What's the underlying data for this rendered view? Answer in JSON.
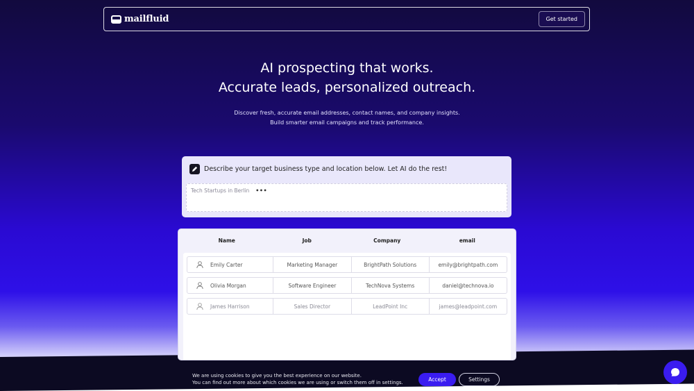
{
  "header": {
    "logo_text": "mailfluid",
    "logo_icon": "mailbox-icon",
    "cta_label": "Get started"
  },
  "hero": {
    "title_line1": "AI prospecting that works.",
    "title_line2": "Accurate leads, personalized outreach.",
    "subtitle_line1": "Discover fresh, accurate email addresses, contact names, and company insights.",
    "subtitle_line2": "Build smarter email campaigns and track performance."
  },
  "prompt": {
    "icon": "pencil-icon",
    "label": "Describe your target business type and location below. Let AI do the rest!",
    "input_value": "Tech Startups in Berlin",
    "typing_indicator": "•••"
  },
  "table": {
    "columns": [
      "Name",
      "Job",
      "Company",
      "email"
    ],
    "rows": [
      {
        "name": "Emily Carter",
        "job": "Marketing Manager",
        "company": "BrightPath Solutions",
        "email": "emily@brightpath.com"
      },
      {
        "name": "Olivia Morgan",
        "job": "Software Engineer",
        "company": "TechNova Systems",
        "email": "daniel@technova.io"
      },
      {
        "name": "James Harrison",
        "job": "Sales Director",
        "company": "LeadPoint Inc",
        "email": "james@leadpoint.com"
      }
    ]
  },
  "cookie": {
    "line1": "We are using cookies to give you the best experience on our website.",
    "line2": "You can find out more about which cookies we are using or switch them off in settings.",
    "accept_label": "Accept",
    "settings_label": "Settings"
  },
  "colors": {
    "accent": "#3a1cf0",
    "bg_top": "#120a3e",
    "bg_mid": "#2e10e8"
  }
}
